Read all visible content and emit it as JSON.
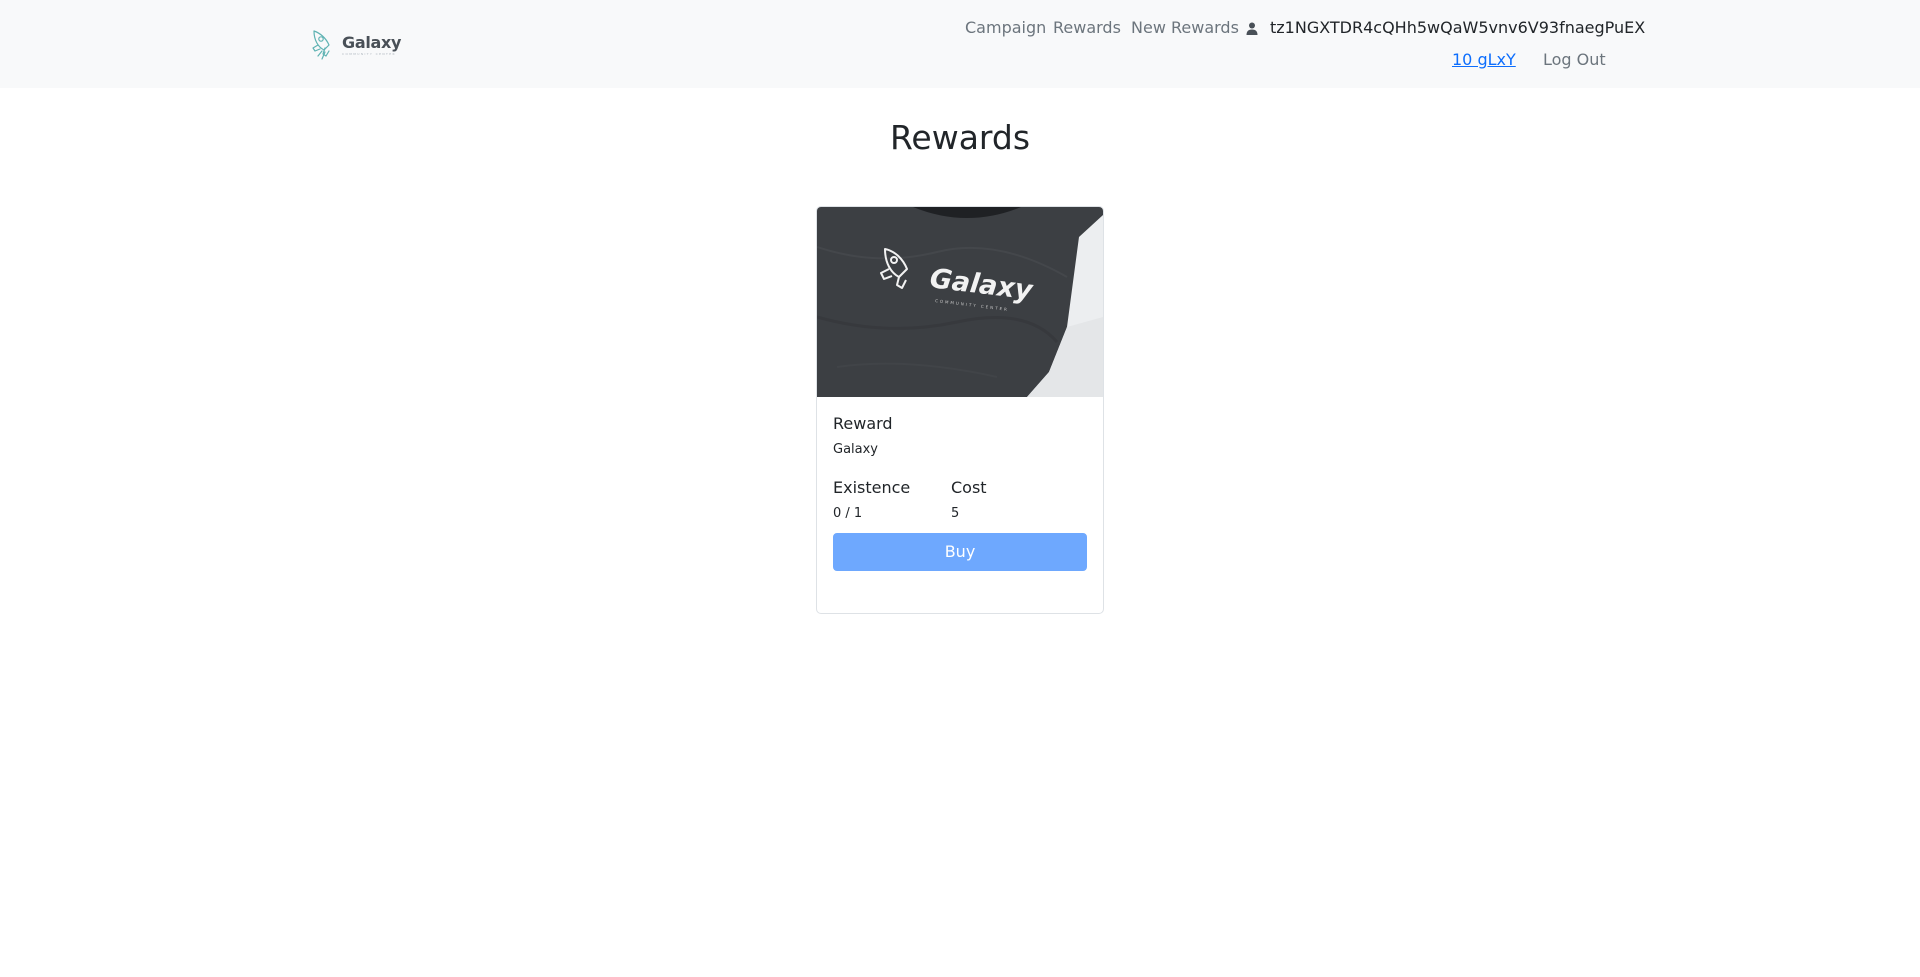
{
  "brand": {
    "name": "Galaxy",
    "tagline": "COMMUNITY CENTER",
    "logo_icon": "rocket-icon"
  },
  "nav": {
    "links": [
      {
        "label": "Campaign"
      },
      {
        "label": "Rewards"
      },
      {
        "label": "New Rewards"
      }
    ],
    "user_icon": "user-icon",
    "wallet_address": "tz1NGXTDR4cQHh5wQaW5vnv6V93fnaegPuEX",
    "balance": "10 gLxY",
    "logout_label": "Log Out"
  },
  "page": {
    "title": "Rewards"
  },
  "rewards": [
    {
      "image_text": "Galaxy",
      "image_tagline": "COMMUNITY CENTER",
      "title": "Reward",
      "subtitle": "Galaxy",
      "existence_label": "Existence",
      "existence_value": "0 / 1",
      "cost_label": "Cost",
      "cost_value": "5",
      "buy_label": "Buy"
    }
  ],
  "colors": {
    "navbar_bg": "#f8f9fa",
    "link_muted": "#6c757d",
    "link_primary": "#0d6efd",
    "button_bg": "#6ea8fe",
    "shirt": "#3c3f43"
  }
}
